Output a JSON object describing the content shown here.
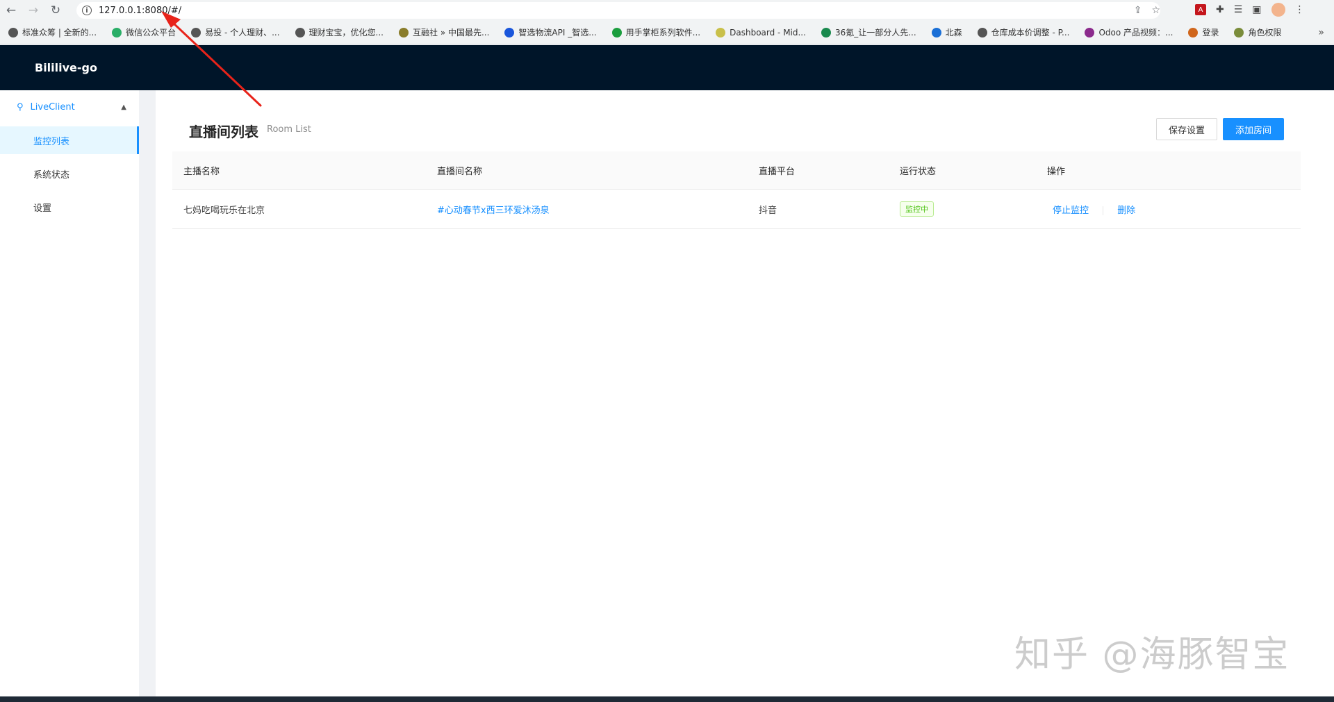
{
  "browser": {
    "url": "127.0.0.1:8080/#/",
    "bookmarks": [
      {
        "label": "标准众筹 | 全新的...",
        "color": "#555555"
      },
      {
        "label": "微信公众平台",
        "color": "#2aae67"
      },
      {
        "label": "易投 - 个人理财、...",
        "color": "#555555"
      },
      {
        "label": "理财宝宝，优化您...",
        "color": "#555555"
      },
      {
        "label": "互融社 » 中国最先...",
        "color": "#8a7d2b"
      },
      {
        "label": "智选物流API _智选...",
        "color": "#1a56db"
      },
      {
        "label": "用手掌柜系列软件...",
        "color": "#1b9e3e"
      },
      {
        "label": "Dashboard - Mid...",
        "color": "#c9c04a"
      },
      {
        "label": "36氪_让一部分人先...",
        "color": "#1a8a4e"
      },
      {
        "label": "北森",
        "color": "#1a6fd6"
      },
      {
        "label": "仓库成本价调整 - P...",
        "color": "#555555"
      },
      {
        "label": "Odoo 产品视频：...",
        "color": "#8b2a8c"
      },
      {
        "label": "登录",
        "color": "#d0661c"
      },
      {
        "label": "角色权限",
        "color": "#7a8c3a"
      }
    ]
  },
  "app": {
    "title": "Bililive-go"
  },
  "sidebar": {
    "group_label": "LiveClient",
    "items": [
      {
        "label": "监控列表",
        "active": true
      },
      {
        "label": "系统状态",
        "active": false
      },
      {
        "label": "设置",
        "active": false
      }
    ]
  },
  "page": {
    "title": "直播间列表",
    "subtitle": "Room List",
    "save_label": "保存设置",
    "add_label": "添加房间"
  },
  "table": {
    "columns": [
      "主播名称",
      "直播间名称",
      "直播平台",
      "运行状态",
      "操作"
    ],
    "rows": [
      {
        "host": "七妈吃喝玩乐在北京",
        "room": "#心动春节x西三环爱沐汤泉",
        "platform": "抖音",
        "status": "监控中",
        "actions": [
          "停止监控",
          "删除"
        ]
      }
    ]
  },
  "watermark": "知乎 @海豚智宝",
  "colors": {
    "header_bg": "#001529",
    "primary": "#1890ff",
    "status_green": "#52c41a",
    "annotation_red": "#e8231a"
  }
}
